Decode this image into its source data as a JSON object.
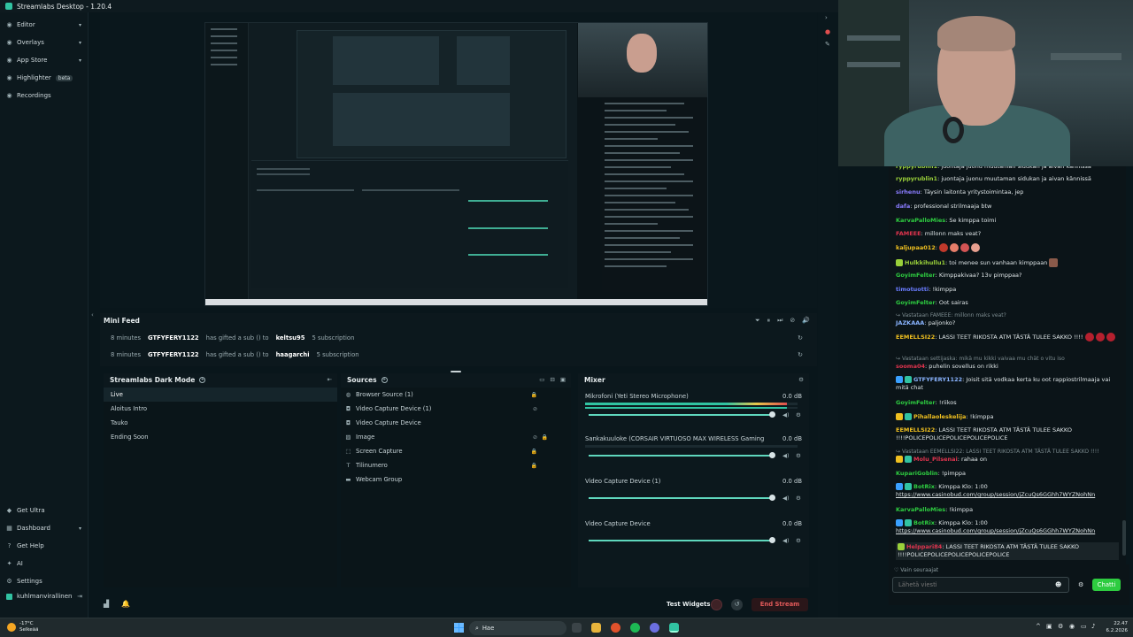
{
  "titlebar": {
    "title": "Streamlabs Desktop - 1.20.4"
  },
  "sidebar": {
    "items": [
      {
        "label": "Editor",
        "icon": "editor-icon"
      },
      {
        "label": "Overlays",
        "icon": "overlays-icon"
      },
      {
        "label": "App Store",
        "icon": "app-store-icon"
      },
      {
        "label": "Highlighter",
        "icon": "highlighter-icon",
        "badge": "beta"
      },
      {
        "label": "Recordings",
        "icon": "recordings-icon"
      }
    ],
    "bottom_items": [
      {
        "label": "Get Ultra",
        "icon": "ultra-icon"
      },
      {
        "label": "Dashboard",
        "icon": "dashboard-icon"
      },
      {
        "label": "Get Help",
        "icon": "help-icon"
      },
      {
        "label": "AI",
        "icon": "ai-icon"
      },
      {
        "label": "Settings",
        "icon": "settings-icon"
      }
    ],
    "user": "kuhlmanvirallinen"
  },
  "minifeed": {
    "title": "Mini Feed",
    "rows": [
      {
        "time": "8 minutes",
        "user": "GTFYFERY1122",
        "text": "has gifted a sub () to",
        "target": "keltsu95",
        "detail": "5 subscription"
      },
      {
        "time": "8 minutes",
        "user": "GTFYFERY1122",
        "text": "has gifted a sub () to",
        "target": "haagarchi",
        "detail": "5 subscription"
      }
    ]
  },
  "scenes": {
    "title": "Streamlabs Dark Mode",
    "items": [
      "Live",
      "Aloitus Intro",
      "Tauko",
      "Ending Soon"
    ],
    "active": "Live"
  },
  "sources": {
    "title": "Sources",
    "items": [
      {
        "label": "Browser Source (1)",
        "icon": "browser-icon"
      },
      {
        "label": "Video Capture Device (1)",
        "icon": "camera-icon"
      },
      {
        "label": "Video Capture Device",
        "icon": "camera-icon"
      },
      {
        "label": "Image",
        "icon": "image-icon"
      },
      {
        "label": "Screen Capture",
        "icon": "screen-icon"
      },
      {
        "label": "Tilinumero",
        "icon": "text-icon"
      },
      {
        "label": "Webcam Group",
        "icon": "folder-icon"
      }
    ]
  },
  "mixer": {
    "title": "Mixer",
    "items": [
      {
        "name": "Mikrofoni (Yeti Stereo Microphone)",
        "db": "0.0 dB",
        "level": 0.95
      },
      {
        "name": "Sankakuuloke (CORSAIR VIRTUOSO MAX WIRELESS Gaming Recei...",
        "db": "0.0 dB",
        "level": 0.0
      },
      {
        "name": "Video Capture Device (1)",
        "db": "0.0 dB",
        "level": 0.0
      },
      {
        "name": "Video Capture Device",
        "db": "0.0 dB",
        "level": 0.0
      }
    ]
  },
  "footer": {
    "test_widgets": "Test Widgets",
    "end_stream": "End Stream"
  },
  "chat": {
    "messages": [
      {
        "user": "ryppyrublin1",
        "color": "#9ad03a",
        "text": "juontaja juonu muutaman sidukan ja aivan kännissä"
      },
      {
        "user": "sirhenu",
        "color": "#8a7cff",
        "text": "Täysin laitonta yritystoimintaa, jep"
      },
      {
        "user": "dafa",
        "color": "#8a7cff",
        "text": "professional strilmaaja btw"
      },
      {
        "user": "KarvaPalloMies",
        "color": "#2ecc40",
        "text": "Se kimppa toimi"
      },
      {
        "user": "FAMEEE",
        "color": "#e0344e",
        "text": "millonn maks veat?"
      },
      {
        "user": "kaljupaa012",
        "color": "#f0c020",
        "text": ""
      },
      {
        "user": "Hulkkihullu1",
        "color": "#9ad03a",
        "text": "toi menee sun vanhaan kimppaan"
      },
      {
        "user": "GoyimFelter",
        "color": "#2ecc40",
        "text": "Kimppakivaa? 13v pimppaa?"
      },
      {
        "user": "timotuotti",
        "color": "#6a7cff",
        "text": "!kimppa"
      },
      {
        "user": "GoyimFelter",
        "color": "#2ecc40",
        "text": "Oot sairas"
      },
      {
        "reply": "Vastataan FAMEEE: millonn maks veat?",
        "user": "JAZKAAA",
        "color": "#8ab4ff",
        "text": "paljonko?"
      },
      {
        "user": "EEMELLSI22",
        "color": "#f0c020",
        "text": "LASSI TEET RIKOSTA ATM TÄSTÄ TULEE SAKKO !!!!"
      },
      {
        "reply": "Vastataan settijaska: mikä mu kikki vaivaa mu chät o vitu iso",
        "user": "sooma04",
        "color": "#e0344e",
        "text": "puhelin sovellus on rikki"
      },
      {
        "user": "GTFYFERY1122",
        "color": "#8ab4ff",
        "text": "Joisit sitä vodkaa kerta ku oot rappiostrilmaaja vai mitä chat"
      },
      {
        "user": "GoyimFelter",
        "color": "#2ecc40",
        "text": "!riikos"
      },
      {
        "user": "Pihallaoleskelija",
        "color": "#f0c020",
        "text": "!kimppa"
      },
      {
        "user": "EEMELLSI22",
        "color": "#f0c020",
        "text": "LASSI TEET RIKOSTA ATM TÄSTÄ TULEE SAKKO !!!!POLICEPOLICEPOLICEPOLICEPOLICE"
      },
      {
        "reply": "Vastataan EEMELLSI22: LASSI TEET RIKOSTA ATM TÄSTÄ TULEE SAKKO !!!!",
        "user": "Molu_Pilsenai",
        "color": "#e0344e",
        "text": "rahaa on"
      },
      {
        "user": "KupariGoblin",
        "color": "#2ecc40",
        "text": "!pimppa"
      },
      {
        "user": "BotRix",
        "color": "#2ecc40",
        "text": "Kimppa Klo: 1:00",
        "link": "https://www.casinobud.com/group/session/jZcuQs6GGhh7WYZNohNn"
      },
      {
        "user": "KarvaPalloMies",
        "color": "#2ecc40",
        "text": "!kimppa"
      },
      {
        "user": "BotRix",
        "color": "#2ecc40",
        "text": "Kimppa Klo: 1:00",
        "link": "https://www.casinobud.com/group/session/jZcuQs6GGhh7WYZNohNn"
      },
      {
        "user": "Helppari84",
        "color": "#e0344e",
        "text": "LASSI TEET RIKOSTA ATM TÄSTÄ TULEE SAKKO !!!!POLICEPOLICEPOLICEPOLICEPOLICE"
      }
    ],
    "follow_only": "Vain seuraajat",
    "placeholder": "Lähetä viesti",
    "send": "Chatti"
  },
  "taskbar": {
    "temp": "-17°C",
    "weather": "Selkeää",
    "search": "Hae",
    "time": "22.47",
    "date": "6.2.2026"
  },
  "colors": {
    "accent": "#31c3a2",
    "end_stream": "#e35a5a",
    "chat_send": "#2ecc40"
  }
}
